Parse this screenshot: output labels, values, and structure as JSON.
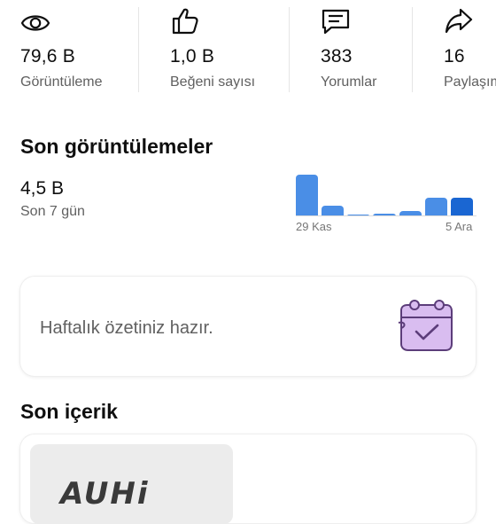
{
  "stats": [
    {
      "icon": "eye-icon",
      "value": "79,6 B",
      "label": "Görüntüleme"
    },
    {
      "icon": "thumbs-up-icon",
      "value": "1,0 B",
      "label": "Beğeni sayısı"
    },
    {
      "icon": "comment-icon",
      "value": "383",
      "label": "Yorumlar"
    },
    {
      "icon": "share-icon",
      "value": "16",
      "label": "Paylaşım"
    }
  ],
  "recent_views": {
    "title": "Son görüntülemeler",
    "value": "4,5 B",
    "period": "Son 7 gün",
    "chart_data": {
      "type": "bar",
      "values": [
        100,
        25,
        4,
        6,
        12,
        44,
        44
      ],
      "colors": [
        "#4a8ee6",
        "#4a8ee6",
        "#4a8ee6",
        "#4a8ee6",
        "#4a8ee6",
        "#4a8ee6",
        "#1a66d2"
      ],
      "x_start_label": "29 Kas",
      "x_end_label": "5 Ara"
    }
  },
  "summary_card": {
    "text": "Haftalık özetiniz hazır.",
    "icon": "calendar-check-icon"
  },
  "recent_content": {
    "title": "Son içerik",
    "thumbnail_text": "AUHi"
  }
}
